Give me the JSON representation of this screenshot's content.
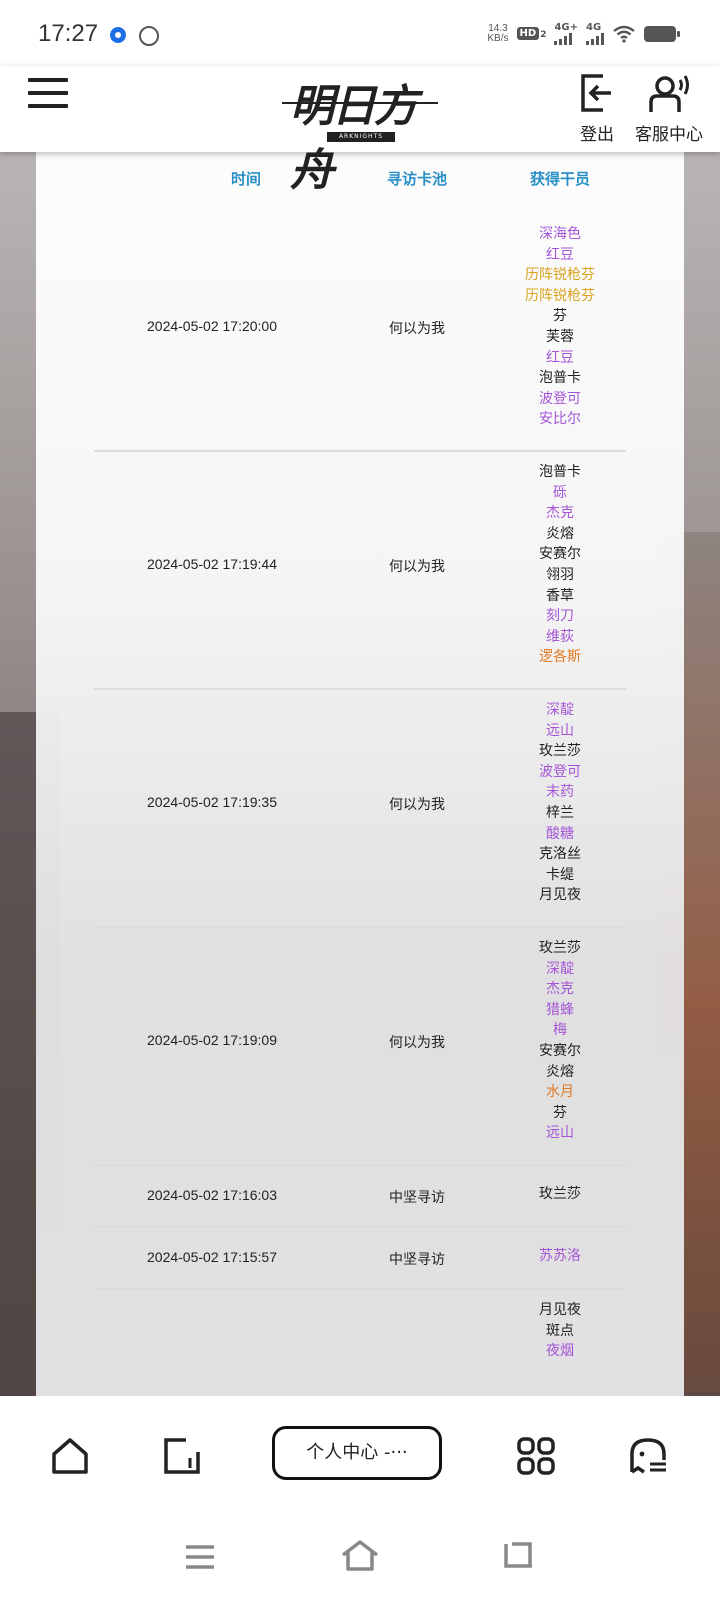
{
  "status_bar": {
    "time": "17:27",
    "net_speed_value": "14.3",
    "net_speed_unit": "KB/s",
    "hd_badge": "HD",
    "hd_sub": "2",
    "sig1_label": "4G+",
    "sig2_label": "4G"
  },
  "header": {
    "logo_text": "明日方舟",
    "logo_sub": "ARKNIGHTS",
    "logout_label": "登出",
    "service_label": "客服中心"
  },
  "table": {
    "headers": {
      "time": "时间",
      "pool": "寻访卡池",
      "operators": "获得干员"
    },
    "rows": [
      {
        "time": "2024-05-02 17:20:00",
        "pool": "何以为我",
        "operators": [
          {
            "name": "深海色",
            "rarity": 4
          },
          {
            "name": "红豆",
            "rarity": 4
          },
          {
            "name": "历阵锐枪芬",
            "rarity": 5
          },
          {
            "name": "历阵锐枪芬",
            "rarity": 5
          },
          {
            "name": "芬",
            "rarity": 3
          },
          {
            "name": "芙蓉",
            "rarity": 3
          },
          {
            "name": "红豆",
            "rarity": 4
          },
          {
            "name": "泡普卡",
            "rarity": 3
          },
          {
            "name": "波登可",
            "rarity": 4
          },
          {
            "name": "安比尔",
            "rarity": 4
          }
        ]
      },
      {
        "time": "2024-05-02 17:19:44",
        "pool": "何以为我",
        "operators": [
          {
            "name": "泡普卡",
            "rarity": 3
          },
          {
            "name": "砾",
            "rarity": 4
          },
          {
            "name": "杰克",
            "rarity": 4
          },
          {
            "name": "炎熔",
            "rarity": 3
          },
          {
            "name": "安赛尔",
            "rarity": 3
          },
          {
            "name": "翎羽",
            "rarity": 3
          },
          {
            "name": "香草",
            "rarity": 3
          },
          {
            "name": "刻刀",
            "rarity": 4
          },
          {
            "name": "维荻",
            "rarity": 4
          },
          {
            "name": "逻各斯",
            "rarity": 6
          }
        ]
      },
      {
        "time": "2024-05-02 17:19:35",
        "pool": "何以为我",
        "operators": [
          {
            "name": "深靛",
            "rarity": 4
          },
          {
            "name": "远山",
            "rarity": 4
          },
          {
            "name": "玫兰莎",
            "rarity": 3
          },
          {
            "name": "波登可",
            "rarity": 4
          },
          {
            "name": "末药",
            "rarity": 4
          },
          {
            "name": "梓兰",
            "rarity": 3
          },
          {
            "name": "酸糖",
            "rarity": 4
          },
          {
            "name": "克洛丝",
            "rarity": 3
          },
          {
            "name": "卡缇",
            "rarity": 3
          },
          {
            "name": "月见夜",
            "rarity": 3
          }
        ]
      },
      {
        "time": "2024-05-02 17:19:09",
        "pool": "何以为我",
        "operators": [
          {
            "name": "玫兰莎",
            "rarity": 3
          },
          {
            "name": "深靛",
            "rarity": 4
          },
          {
            "name": "杰克",
            "rarity": 4
          },
          {
            "name": "猎蜂",
            "rarity": 4
          },
          {
            "name": "梅",
            "rarity": 4
          },
          {
            "name": "安赛尔",
            "rarity": 3
          },
          {
            "name": "炎熔",
            "rarity": 3
          },
          {
            "name": "水月",
            "rarity": 6
          },
          {
            "name": "芬",
            "rarity": 3
          },
          {
            "name": "远山",
            "rarity": 4
          }
        ]
      },
      {
        "time": "2024-05-02 17:16:03",
        "pool": "中坚寻访",
        "operators": [
          {
            "name": "玫兰莎",
            "rarity": 3
          }
        ]
      },
      {
        "time": "2024-05-02 17:15:57",
        "pool": "中坚寻访",
        "operators": [
          {
            "name": "苏苏洛",
            "rarity": 4
          }
        ]
      },
      {
        "time": "",
        "pool": "",
        "operators": [
          {
            "name": "月见夜",
            "rarity": 3
          },
          {
            "name": "斑点",
            "rarity": 3
          },
          {
            "name": "夜烟",
            "rarity": 4
          }
        ]
      }
    ]
  },
  "rarity_colors": {
    "3": "#222222",
    "4": "#a455d6",
    "5": "#d8a21d",
    "6": "#e07a24"
  },
  "bottom_bar": {
    "user_center_label": "个人中心 -···",
    "icons": [
      "home-icon",
      "tab-icon",
      "grid-icon",
      "ghost-icon"
    ]
  },
  "system_nav": {
    "icons": [
      "menu-icon",
      "home-icon",
      "back-icon"
    ]
  }
}
